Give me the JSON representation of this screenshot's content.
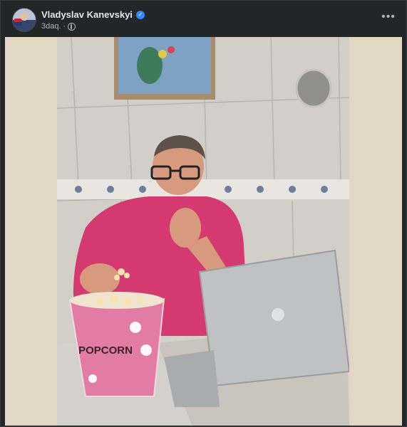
{
  "post": {
    "author": "Vladyslav Kanevskyi",
    "verified_icon": "verified-badge-icon",
    "time": "3daq.",
    "separator": "·",
    "audience_icon": "globe-icon",
    "more_label": "•••"
  },
  "photo": {
    "bucket_text": "POPCORN"
  },
  "colors": {
    "card_bg": "#242526",
    "text_primary": "#e4e6eb",
    "text_secondary": "#b0b3b8",
    "verified": "#2d88ff",
    "media_border": "#e2d7c3"
  }
}
